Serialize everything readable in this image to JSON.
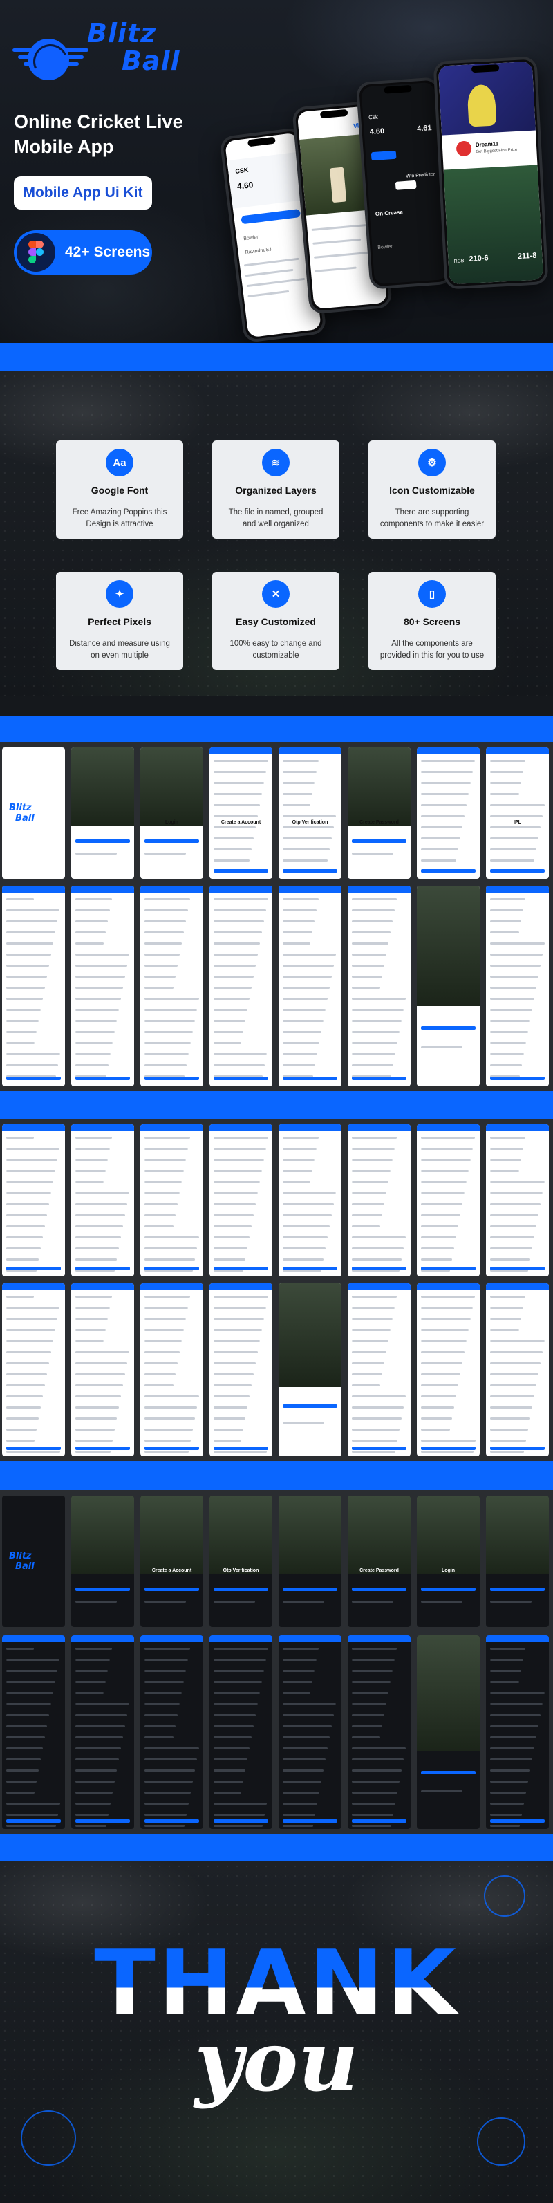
{
  "brand": {
    "line1": "Blitz",
    "line2": "Ball"
  },
  "hero": {
    "title": "Online Cricket Live Mobile App",
    "kit_button": "Mobile App Ui Kit",
    "screens_badge": "42+ Screens"
  },
  "phones": {
    "p1": {
      "name": "CSK",
      "score": "4.60",
      "lbl1": "Bowler",
      "lbl2": "Ravindra SJ"
    },
    "p2": {
      "title": "Vivo"
    },
    "p3": {
      "team": "Csk",
      "score1": "4.60",
      "score2": "4.61",
      "lbl": "On Crease",
      "bowl": "Bowler",
      "fan": "Win Predictor"
    },
    "p4": {
      "title": "Dream11",
      "subtitle": "Get Biggest First Prize",
      "score_a": "210-6",
      "score_b": "211-8",
      "team_a": "RCB"
    }
  },
  "features": [
    {
      "icon": "Aa",
      "icon_name": "font-icon",
      "title": "Google Font",
      "desc": "Free Amazing Poppins this Design is attractive"
    },
    {
      "icon": "≋",
      "icon_name": "layers-icon",
      "title": "Organized Layers",
      "desc": "The file in named, grouped and well organized"
    },
    {
      "icon": "⚙",
      "icon_name": "customize-icon",
      "title": "Icon Customizable",
      "desc": "There are supporting components to make it easier"
    },
    {
      "icon": "✦",
      "icon_name": "pixels-icon",
      "title": "Perfect Pixels",
      "desc": "Distance and measure using on even multiple"
    },
    {
      "icon": "✕",
      "icon_name": "tools-icon",
      "title": "Easy Customized",
      "desc": "100% easy to change and customizable"
    },
    {
      "icon": "▯",
      "icon_name": "phone-icon",
      "title": "80+ Screens",
      "desc": "All the components are provided in this for you to use"
    }
  ],
  "screens": {
    "login": "Login",
    "create": "Create a Account",
    "otp": "Otp Verification",
    "password": "Create Password",
    "ipl": "IPL"
  },
  "thanks": {
    "line1": "THANK",
    "line2": "you"
  },
  "colors": {
    "accent": "#0a66ff",
    "bg": "#15181c",
    "card": "#eceef1"
  }
}
